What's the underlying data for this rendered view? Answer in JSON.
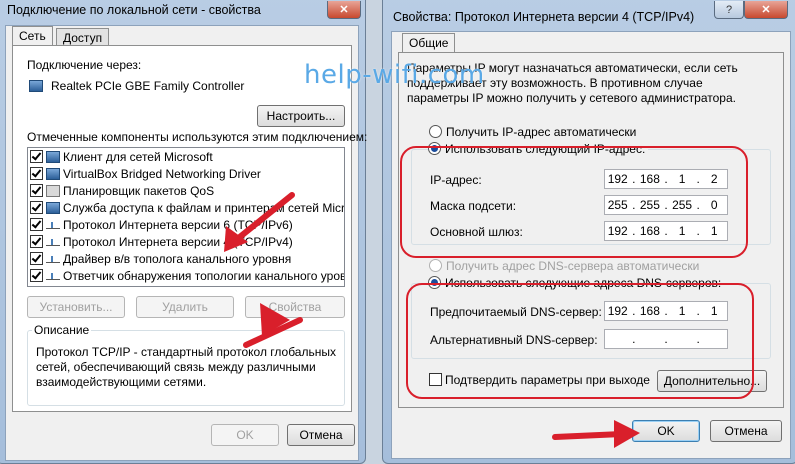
{
  "left_dialog": {
    "title": "Подключение по локальной сети - свойства",
    "close_label": "✕",
    "tabs": [
      "Сеть",
      "Доступ"
    ],
    "connect_via_label": "Подключение через:",
    "adapter_name": "Realtek PCIe GBE Family Controller",
    "configure_button": "Настроить...",
    "components_label": "Отмеченные компоненты используются этим подключением:",
    "components": [
      {
        "label": "Клиент для сетей Microsoft",
        "icon": "network-client-icon",
        "checked": true
      },
      {
        "label": "VirtualBox Bridged Networking Driver",
        "icon": "network-driver-icon",
        "checked": true
      },
      {
        "label": "Планировщик пакетов QoS",
        "icon": "scheduler-icon",
        "checked": true
      },
      {
        "label": "Служба доступа к файлам и принтерам сетей Micro...",
        "icon": "file-sharing-icon",
        "checked": true
      },
      {
        "label": "Протокол Интернета версии 6 (TCP/IPv6)",
        "icon": "protocol-icon",
        "checked": true
      },
      {
        "label": "Протокол Интернета версии 4 (TCP/IPv4)",
        "icon": "protocol-icon",
        "checked": true
      },
      {
        "label": "Драйвер в/в тополога канального уровня",
        "icon": "protocol-icon",
        "checked": true
      },
      {
        "label": "Ответчик обнаружения топологии канального уровня",
        "icon": "protocol-icon",
        "checked": true
      }
    ],
    "install_button": "Установить...",
    "remove_button": "Удалить",
    "properties_button": "Свойства",
    "description_label": "Описание",
    "description_text": "Протокол TCP/IP - стандартный протокол глобальных сетей, обеспечивающий связь между различными взаимодействующими сетями.",
    "ok_button": "OK",
    "cancel_button": "Отмена"
  },
  "right_dialog": {
    "title": "Свойства: Протокол Интернета версии 4 (TCP/IPv4)",
    "help_label": "?",
    "close_label": "✕",
    "tab": "Общие",
    "info_text": "Параметры IP могут назначаться автоматически, если сеть поддерживает эту возможность. В противном случае параметры IP можно получить у сетевого администратора.",
    "auto_ip_label": "Получить IP-адрес автоматически",
    "manual_ip_label": "Использовать следующий IP-адрес:",
    "ip_label": "IP-адрес:",
    "ip_value": [
      "192",
      "168",
      "1",
      "2"
    ],
    "mask_label": "Маска подсети:",
    "mask_value": [
      "255",
      "255",
      "255",
      "0"
    ],
    "gateway_label": "Основной шлюз:",
    "gateway_value": [
      "192",
      "168",
      "1",
      "1"
    ],
    "auto_dns_label": "Получить адрес DNS-сервера автоматически",
    "manual_dns_label": "Использовать следующие адреса DNS-серверов:",
    "preferred_dns_label": "Предпочитаемый DNS-сервер:",
    "preferred_dns_value": [
      "192",
      "168",
      "1",
      "1"
    ],
    "alternate_dns_label": "Альтернативный DNS-сервер:",
    "alternate_dns_value": [
      "",
      "",
      "",
      ""
    ],
    "validate_label": "Подтвердить параметры при выходе",
    "advanced_button": "Дополнительно...",
    "ok_button": "OK",
    "cancel_button": "Отмена"
  },
  "watermark": "help-wifi.com",
  "colors": {
    "annotation_red": "#d91f2b",
    "window_frame": "#a5bedb",
    "watermark": "#5aa9e6"
  }
}
